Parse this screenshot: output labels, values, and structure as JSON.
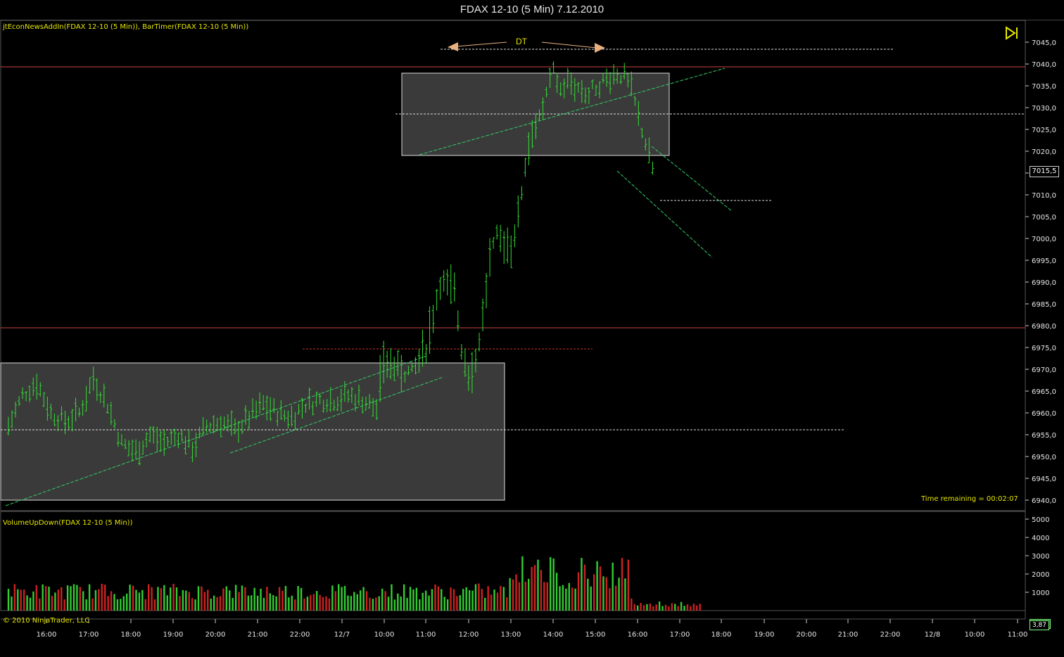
{
  "window": {
    "title": "FDAX 12-10 (5 Min)  7.12.2010"
  },
  "price_panel": {
    "indicator_label": "jtEconNewsAddIn(FDAX 12-10 (5 Min)), BarTimer(FDAX 12-10 (5 Min))",
    "time_remaining": "Time remaining = 00:02:07",
    "current_price": "7015,5",
    "annotation_text": "DT"
  },
  "volume_panel": {
    "indicator_label": "VolumeUpDown(FDAX 12-10 (5 Min))",
    "current_value": "23"
  },
  "footer": {
    "copyright": "© 2010 NinjaTrader, LLC",
    "scale_value": "3,87"
  },
  "icons": {
    "play": "play-to-end-icon"
  },
  "colors": {
    "up": "#33cc33",
    "down": "#cc2222",
    "bar": "#33dd33",
    "trendline": "#33cc66",
    "hline_red": "#cc3333",
    "accent": "#e6e600"
  },
  "chart_data": [
    {
      "type": "ohlc",
      "title": "FDAX 12-10 (5 Min)  7.12.2010",
      "ylim": [
        6937,
        7049
      ],
      "y_ticks": [
        "7045,0",
        "7040,0",
        "7035,0",
        "7030,0",
        "7025,0",
        "7020,0",
        "7015,0",
        "7010,0",
        "7005,0",
        "7000,0",
        "6995,0",
        "6990,0",
        "6985,0",
        "6980,0",
        "6975,0",
        "6970,0",
        "6965,0",
        "6960,0",
        "6955,0",
        "6950,0",
        "6945,0",
        "6940,0"
      ],
      "y_tick_values": [
        7045,
        7040,
        7035,
        7030,
        7025,
        7020,
        7015,
        7010,
        7005,
        7000,
        6995,
        6990,
        6985,
        6980,
        6975,
        6970,
        6965,
        6960,
        6955,
        6950,
        6945,
        6940
      ],
      "x_ticks": [
        "16:00",
        "17:00",
        "18:00",
        "19:00",
        "20:00",
        "21:00",
        "22:00",
        "12/7",
        "10:00",
        "11:00",
        "12:00",
        "13:00",
        "14:00",
        "15:00",
        "16:00",
        "17:00",
        "18:00",
        "19:00",
        "20:00",
        "21:00",
        "22:00",
        "12/8",
        "10:00",
        "11:00"
      ],
      "bar_count": 186,
      "bar_x_start": 0,
      "anchors": [
        {
          "i": 0,
          "p": 6957
        },
        {
          "i": 4,
          "p": 6964
        },
        {
          "i": 8,
          "p": 6967
        },
        {
          "i": 12,
          "p": 6960
        },
        {
          "i": 16,
          "p": 6958
        },
        {
          "i": 20,
          "p": 6960
        },
        {
          "i": 24,
          "p": 6968
        },
        {
          "i": 28,
          "p": 6962
        },
        {
          "i": 32,
          "p": 6953
        },
        {
          "i": 36,
          "p": 6951
        },
        {
          "i": 40,
          "p": 6955
        },
        {
          "i": 44,
          "p": 6953
        },
        {
          "i": 48,
          "p": 6955
        },
        {
          "i": 52,
          "p": 6952
        },
        {
          "i": 56,
          "p": 6957
        },
        {
          "i": 60,
          "p": 6958
        },
        {
          "i": 64,
          "p": 6956
        },
        {
          "i": 68,
          "p": 6959
        },
        {
          "i": 72,
          "p": 6962
        },
        {
          "i": 76,
          "p": 6960
        },
        {
          "i": 80,
          "p": 6959
        },
        {
          "i": 84,
          "p": 6962
        },
        {
          "i": 88,
          "p": 6963
        },
        {
          "i": 92,
          "p": 6963
        },
        {
          "i": 96,
          "p": 6964
        },
        {
          "i": 100,
          "p": 6963
        },
        {
          "i": 104,
          "p": 6961
        },
        {
          "i": 106,
          "p": 6972
        },
        {
          "i": 110,
          "p": 6970
        },
        {
          "i": 114,
          "p": 6969
        },
        {
          "i": 118,
          "p": 6975
        },
        {
          "i": 122,
          "p": 6990
        },
        {
          "i": 126,
          "p": 6988
        },
        {
          "i": 128,
          "p": 6975
        },
        {
          "i": 130,
          "p": 6969
        },
        {
          "i": 132,
          "p": 6972
        },
        {
          "i": 134,
          "p": 6982
        },
        {
          "i": 136,
          "p": 6995
        },
        {
          "i": 138,
          "p": 7000
        },
        {
          "i": 140,
          "p": 6999
        },
        {
          "i": 142,
          "p": 6998
        },
        {
          "i": 144,
          "p": 7005
        },
        {
          "i": 146,
          "p": 7017
        },
        {
          "i": 148,
          "p": 7025
        },
        {
          "i": 150,
          "p": 7027
        },
        {
          "i": 152,
          "p": 7033
        },
        {
          "i": 154,
          "p": 7038
        },
        {
          "i": 156,
          "p": 7034
        }
      ]
    },
    {
      "type": "bar",
      "title": "VolumeUpDown(FDAX 12-10 (5 Min))",
      "ylim": [
        0,
        5200
      ],
      "y_ticks": [
        "5000",
        "4000",
        "3000",
        "2000",
        "1000"
      ],
      "y_tick_values": [
        5000,
        4000,
        3000,
        2000,
        1000
      ],
      "series": [
        {
          "name": "up",
          "color": "#33cc33"
        },
        {
          "name": "down",
          "color": "#cc2222"
        }
      ]
    }
  ]
}
